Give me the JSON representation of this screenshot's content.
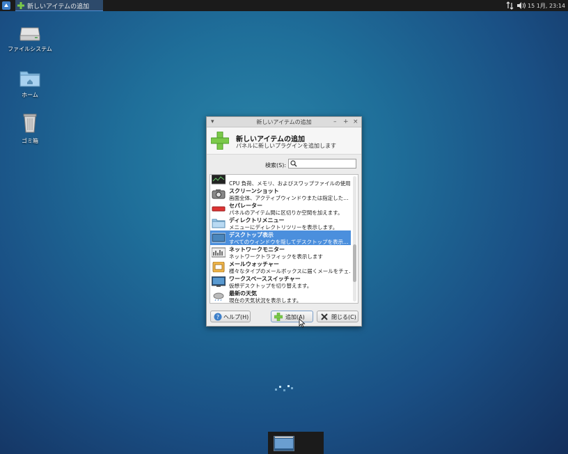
{
  "panel": {
    "task_title": "新しいアイテムの追加",
    "clock": "15 1月, 23:14"
  },
  "desktop": {
    "icons": [
      {
        "label": "ファイルシステム",
        "icon": "drive-icon"
      },
      {
        "label": "ホーム",
        "icon": "home-folder-icon"
      },
      {
        "label": "ゴミ箱",
        "icon": "trash-icon"
      }
    ]
  },
  "dialog": {
    "window_title": "新しいアイテムの追加",
    "header_title": "新しいアイテムの追加",
    "header_subtitle": "パネルに新しいプラグインを追加します",
    "search_label": "検索(S):",
    "search_value": "",
    "items": [
      {
        "name": "",
        "desc": "CPU 負荷、メモリ、およびスワップファイルの使用…",
        "icon": "system-monitor-icon"
      },
      {
        "name": "スクリーンショット",
        "desc": "画面全体、アクティブウィンドウまたは指定した…",
        "icon": "camera-icon"
      },
      {
        "name": "セパレーター",
        "desc": "パネルのアイテム間に区切りか空間を加えます。",
        "icon": "separator-icon"
      },
      {
        "name": "ディレクトリメニュー",
        "desc": "メニューにディレクトリツリーを表示します。",
        "icon": "folder-icon"
      },
      {
        "name": "デスクトップ表示",
        "desc": "すべてのウィンドウを隠してデスクトップを表示…",
        "icon": "desktop-icon"
      },
      {
        "name": "ネットワークモニター",
        "desc": "ネットワークトラフィックを表示します",
        "icon": "network-monitor-icon"
      },
      {
        "name": "メールウォッチャー",
        "desc": "様々なタイプのメールボックスに届くメールをチェ…",
        "icon": "mail-icon"
      },
      {
        "name": "ワークスペーススイッチャー",
        "desc": "仮想デスクトップを切り替えます。",
        "icon": "workspace-icon"
      },
      {
        "name": "最新の天気",
        "desc": "現在の天気状況を表示します。",
        "icon": "weather-icon"
      }
    ],
    "selected_index": 4,
    "help_label": "ヘルプ(H)",
    "add_label": "追加(A)",
    "close_label": "閉じる(C)"
  },
  "colors": {
    "selection": "#4b8fdd",
    "add_green": "#6cbf3a"
  }
}
